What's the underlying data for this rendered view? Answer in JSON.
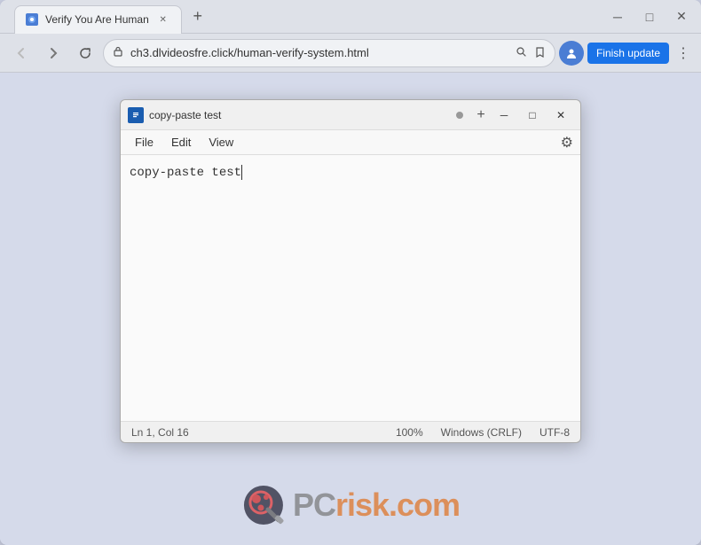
{
  "browser": {
    "tab": {
      "title": "Verify You Are Human",
      "favicon": "📄"
    },
    "new_tab_label": "+",
    "window_controls": {
      "minimize": "—",
      "maximize": "□",
      "close": "✕"
    },
    "nav": {
      "back_label": "←",
      "forward_label": "→",
      "reload_label": "↻",
      "url": "ch3.dlvideosfre.click/human-verify-system.html",
      "search_icon": "🔍",
      "bookmark_icon": "☆",
      "profile_icon": "👤",
      "finish_update_label": "Finish update",
      "menu_icon": "⋮"
    }
  },
  "notepad": {
    "favicon": "📝",
    "title": "copy-paste test",
    "dot": "●",
    "new_tab": "+",
    "window_controls": {
      "minimize": "—",
      "maximize": "□",
      "close": "✕"
    },
    "menu": {
      "file": "File",
      "edit": "Edit",
      "view": "View"
    },
    "editor_content": "copy-paste test",
    "statusbar": {
      "position": "Ln 1, Col 16",
      "zoom": "100%",
      "line_ending": "Windows (CRLF)",
      "encoding": "UTF-8"
    }
  },
  "watermark": {
    "pc": "PC",
    "risk": "risk",
    "dotcom": ".com"
  }
}
